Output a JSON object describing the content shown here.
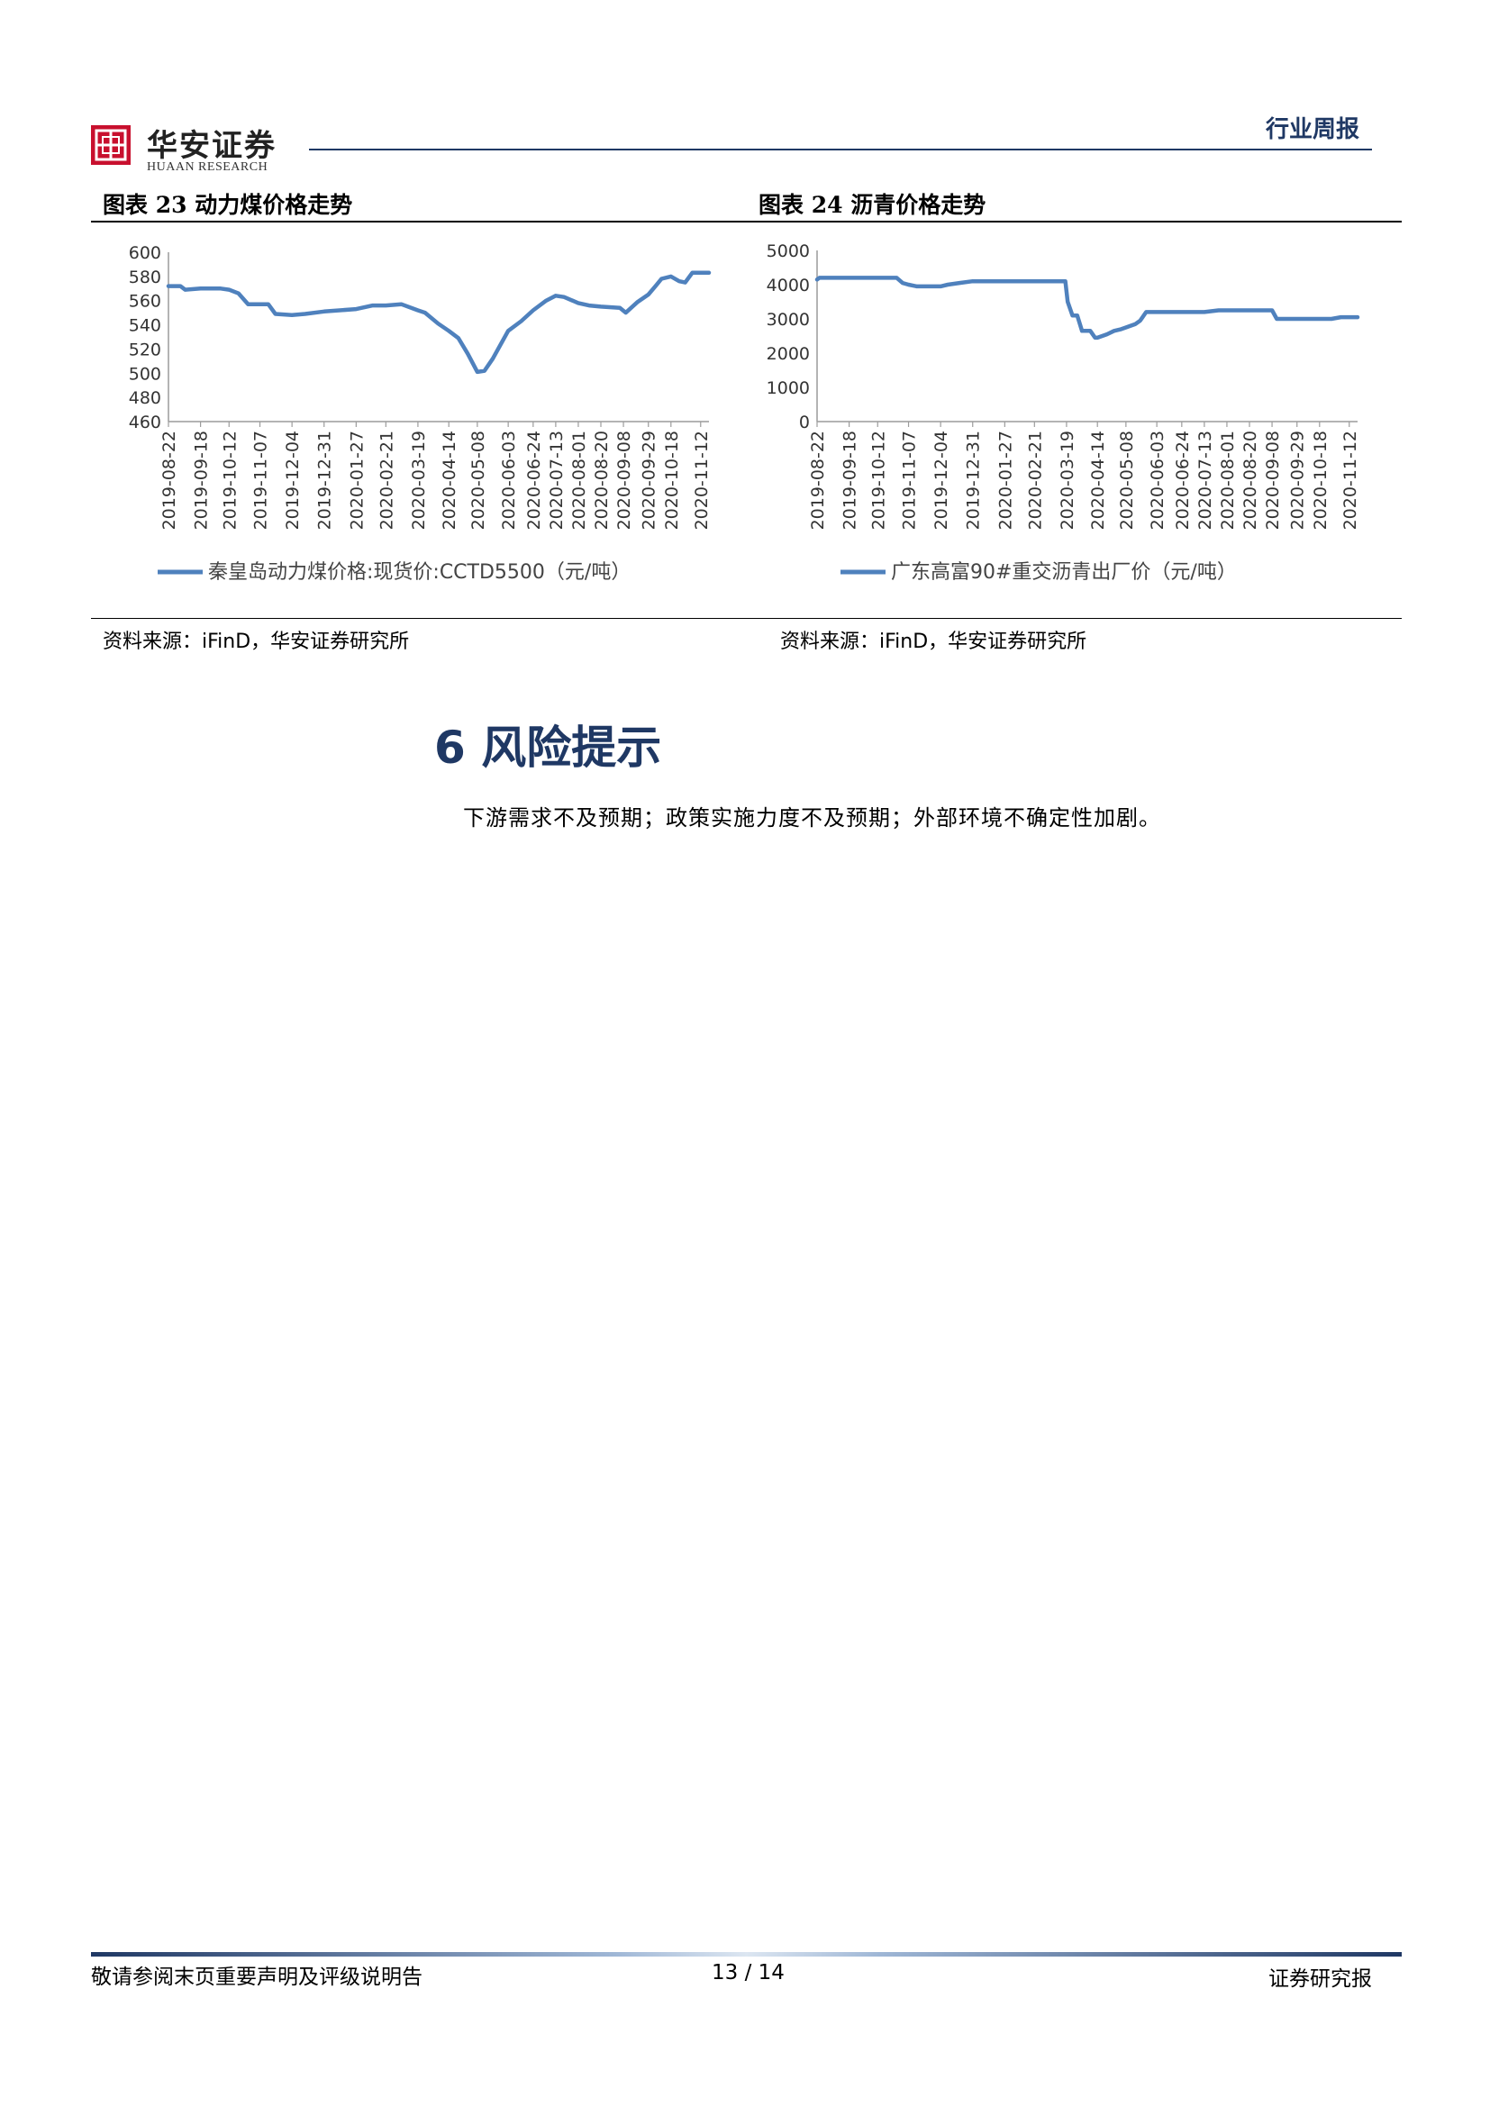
{
  "header": {
    "logo_cn": "华安证券",
    "logo_en": "HUAAN RESEARCH",
    "report_type": "行业周报"
  },
  "figures": [
    {
      "title": "图表 23  动力煤价格走势",
      "source": "资料来源：iFinD，华安证券研究所"
    },
    {
      "title": "图表 24  沥青价格走势",
      "source": "资料来源：iFinD，华安证券研究所"
    }
  ],
  "chart_data": [
    {
      "type": "line",
      "color": "#4f81bd",
      "ylim": [
        460,
        600
      ],
      "yticks": [
        460,
        480,
        500,
        520,
        540,
        560,
        580,
        600
      ],
      "xlim": [
        "2019-08-22",
        "2020-11-19"
      ],
      "xticks": [
        "2019-08-22",
        "2019-09-18",
        "2019-10-12",
        "2019-11-07",
        "2019-12-04",
        "2019-12-31",
        "2020-01-27",
        "2020-02-21",
        "2020-03-19",
        "2020-04-14",
        "2020-05-08",
        "2020-06-03",
        "2020-06-24",
        "2020-07-13",
        "2020-08-01",
        "2020-08-20",
        "2020-09-08",
        "2020-09-29",
        "2020-10-18",
        "2020-11-12"
      ],
      "series": [
        {
          "name": "秦皇岛动力煤价格:现货价:CCTD5500（元/吨）",
          "x": [
            "2019-08-22",
            "2019-09-01",
            "2019-09-05",
            "2019-09-18",
            "2019-10-05",
            "2019-10-12",
            "2019-10-20",
            "2019-10-28",
            "2019-11-01",
            "2019-11-07",
            "2019-11-14",
            "2019-11-20",
            "2019-12-04",
            "2019-12-15",
            "2019-12-31",
            "2020-01-27",
            "2020-02-10",
            "2020-02-21",
            "2020-03-05",
            "2020-03-19",
            "2020-03-25",
            "2020-04-05",
            "2020-04-14",
            "2020-04-22",
            "2020-04-30",
            "2020-05-08",
            "2020-05-14",
            "2020-05-21",
            "2020-06-03",
            "2020-06-14",
            "2020-06-24",
            "2020-07-05",
            "2020-07-13",
            "2020-07-20",
            "2020-08-01",
            "2020-08-10",
            "2020-08-20",
            "2020-09-05",
            "2020-09-10",
            "2020-09-20",
            "2020-09-29",
            "2020-10-05",
            "2020-10-10",
            "2020-10-18",
            "2020-10-25",
            "2020-10-30",
            "2020-11-05",
            "2020-11-12",
            "2020-11-19"
          ],
          "y": [
            572,
            572,
            569,
            570,
            570,
            569,
            566,
            557,
            557,
            557,
            557,
            549,
            548,
            549,
            551,
            553,
            556,
            556,
            557,
            552,
            550,
            541,
            535,
            529,
            516,
            501,
            502,
            512,
            535,
            543,
            552,
            560,
            564,
            563,
            558,
            556,
            555,
            554,
            550,
            559,
            565,
            572,
            578,
            580,
            576,
            575,
            583,
            583,
            583
          ]
        }
      ]
    },
    {
      "type": "line",
      "color": "#4f81bd",
      "ylim": [
        0,
        5000
      ],
      "yticks": [
        0,
        1000,
        2000,
        3000,
        4000,
        5000
      ],
      "xlim": [
        "2019-08-22",
        "2020-11-19"
      ],
      "xticks": [
        "2019-08-22",
        "2019-09-18",
        "2019-10-12",
        "2019-11-07",
        "2019-12-04",
        "2019-12-31",
        "2020-01-27",
        "2020-02-21",
        "2020-03-19",
        "2020-04-14",
        "2020-05-08",
        "2020-06-03",
        "2020-06-24",
        "2020-07-13",
        "2020-08-01",
        "2020-08-20",
        "2020-09-08",
        "2020-09-29",
        "2020-10-18",
        "2020-11-12"
      ],
      "series": [
        {
          "name": "广东高富90#重交沥青出厂价（元/吨）",
          "x": [
            "2019-08-22",
            "2019-08-24",
            "2019-09-18",
            "2019-10-12",
            "2019-10-28",
            "2019-11-02",
            "2019-11-07",
            "2019-11-14",
            "2019-11-24",
            "2019-12-04",
            "2019-12-10",
            "2019-12-20",
            "2019-12-31",
            "2020-01-27",
            "2020-02-21",
            "2020-03-18",
            "2020-03-20",
            "2020-03-24",
            "2020-03-28",
            "2020-04-01",
            "2020-04-08",
            "2020-04-12",
            "2020-04-14",
            "2020-04-22",
            "2020-04-28",
            "2020-05-04",
            "2020-05-08",
            "2020-05-12",
            "2020-05-16",
            "2020-05-20",
            "2020-05-25",
            "2020-06-03",
            "2020-06-24",
            "2020-07-13",
            "2020-07-25",
            "2020-08-01",
            "2020-08-20",
            "2020-09-08",
            "2020-09-12",
            "2020-09-29",
            "2020-10-18",
            "2020-10-28",
            "2020-11-05",
            "2020-11-19"
          ],
          "y": [
            4150,
            4200,
            4200,
            4200,
            4200,
            4050,
            4000,
            3950,
            3950,
            3950,
            4000,
            4050,
            4100,
            4100,
            4100,
            4100,
            3500,
            3100,
            3100,
            2650,
            2650,
            2450,
            2450,
            2550,
            2650,
            2700,
            2750,
            2800,
            2850,
            2950,
            3200,
            3200,
            3200,
            3200,
            3250,
            3250,
            3250,
            3250,
            3000,
            3000,
            3000,
            3000,
            3050,
            3050
          ]
        }
      ]
    }
  ],
  "section": {
    "title": "6  风险提示",
    "body": "下游需求不及预期；政策实施力度不及预期；外部环境不确定性加剧。"
  },
  "footer": {
    "left": "敬请参阅末页重要声明及评级说明告",
    "page": "13 / 14",
    "right": "证券研究报"
  }
}
